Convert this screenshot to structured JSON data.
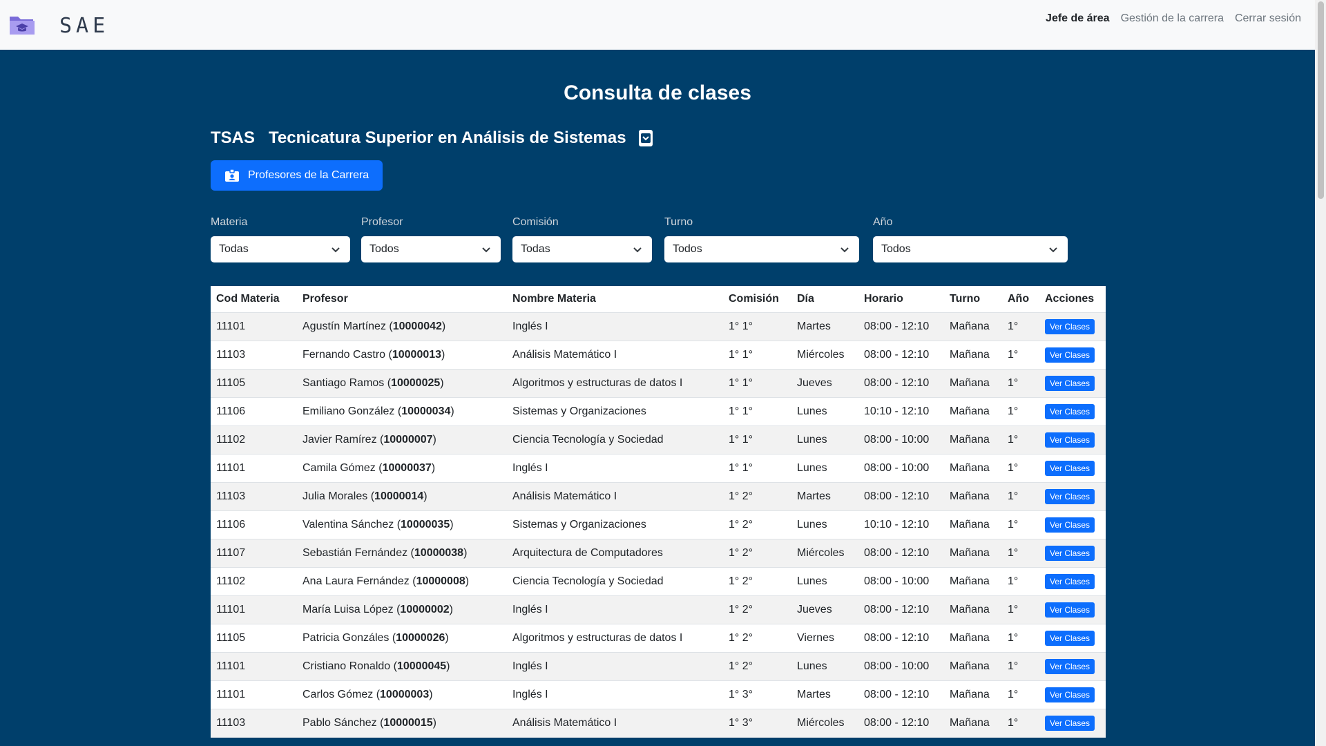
{
  "brand": {
    "name": "SAE",
    "logo_icon": "folder-graduation-icon"
  },
  "nav": {
    "links": [
      {
        "label": "Jefe de área",
        "active": true
      },
      {
        "label": "Gestión de la carrera",
        "active": false
      },
      {
        "label": "Cerrar sesión",
        "active": false
      }
    ]
  },
  "page": {
    "title": "Consulta de clases",
    "career_code": "TSAS",
    "career_name": "Tecnicatura Superior en Análisis de Sistemas",
    "professors_button": "Profesores de la Carrera"
  },
  "filters": [
    {
      "label": "Materia",
      "value": "Todas"
    },
    {
      "label": "Profesor",
      "value": "Todos"
    },
    {
      "label": "Comisión",
      "value": "Todas"
    },
    {
      "label": "Turno",
      "value": "Todos"
    },
    {
      "label": "Año",
      "value": "Todos"
    }
  ],
  "table": {
    "headers": [
      "Cod Materia",
      "Profesor",
      "Nombre Materia",
      "Comisión",
      "Día",
      "Horario",
      "Turno",
      "Año",
      "Acciones"
    ],
    "action_label": "Ver Clases",
    "rows": [
      {
        "cod": "11101",
        "prof": "Agustín Martínez",
        "dni": "10000042",
        "materia": "Inglés I",
        "comision": "1° 1°",
        "dia": "Martes",
        "horario": "08:00 - 12:10",
        "turno": "Mañana",
        "anio": "1°"
      },
      {
        "cod": "11103",
        "prof": "Fernando Castro",
        "dni": "10000013",
        "materia": "Análisis Matemático I",
        "comision": "1° 1°",
        "dia": "Miércoles",
        "horario": "08:00 - 12:10",
        "turno": "Mañana",
        "anio": "1°"
      },
      {
        "cod": "11105",
        "prof": "Santiago Ramos",
        "dni": "10000025",
        "materia": "Algoritmos y estructuras de datos I",
        "comision": "1° 1°",
        "dia": "Jueves",
        "horario": "08:00 - 12:10",
        "turno": "Mañana",
        "anio": "1°"
      },
      {
        "cod": "11106",
        "prof": "Emiliano González",
        "dni": "10000034",
        "materia": "Sistemas y Organizaciones",
        "comision": "1° 1°",
        "dia": "Lunes",
        "horario": "10:10 - 12:10",
        "turno": "Mañana",
        "anio": "1°"
      },
      {
        "cod": "11102",
        "prof": "Javier Ramírez",
        "dni": "10000007",
        "materia": "Ciencia Tecnología y Sociedad",
        "comision": "1° 1°",
        "dia": "Lunes",
        "horario": "08:00 - 10:00",
        "turno": "Mañana",
        "anio": "1°"
      },
      {
        "cod": "11101",
        "prof": "Camila Gómez",
        "dni": "10000037",
        "materia": "Inglés I",
        "comision": "1° 1°",
        "dia": "Lunes",
        "horario": "08:00 - 10:00",
        "turno": "Mañana",
        "anio": "1°"
      },
      {
        "cod": "11103",
        "prof": "Julia Morales",
        "dni": "10000014",
        "materia": "Análisis Matemático I",
        "comision": "1° 2°",
        "dia": "Martes",
        "horario": "08:00 - 12:10",
        "turno": "Mañana",
        "anio": "1°"
      },
      {
        "cod": "11106",
        "prof": "Valentina Sánchez",
        "dni": "10000035",
        "materia": "Sistemas y Organizaciones",
        "comision": "1° 2°",
        "dia": "Lunes",
        "horario": "10:10 - 12:10",
        "turno": "Mañana",
        "anio": "1°"
      },
      {
        "cod": "11107",
        "prof": "Sebastián Fernández",
        "dni": "10000038",
        "materia": "Arquitectura de Computadores",
        "comision": "1° 2°",
        "dia": "Miércoles",
        "horario": "08:00 - 12:10",
        "turno": "Mañana",
        "anio": "1°"
      },
      {
        "cod": "11102",
        "prof": "Ana Laura Fernández",
        "dni": "10000008",
        "materia": "Ciencia Tecnología y Sociedad",
        "comision": "1° 2°",
        "dia": "Lunes",
        "horario": "08:00 - 10:00",
        "turno": "Mañana",
        "anio": "1°"
      },
      {
        "cod": "11101",
        "prof": "María Luisa López",
        "dni": "10000002",
        "materia": "Inglés I",
        "comision": "1° 2°",
        "dia": "Jueves",
        "horario": "08:00 - 12:10",
        "turno": "Mañana",
        "anio": "1°"
      },
      {
        "cod": "11105",
        "prof": "Patricia Gonzáles",
        "dni": "10000026",
        "materia": "Algoritmos y estructuras de datos I",
        "comision": "1° 2°",
        "dia": "Viernes",
        "horario": "08:00 - 12:10",
        "turno": "Mañana",
        "anio": "1°"
      },
      {
        "cod": "11101",
        "prof": "Cristiano Ronaldo",
        "dni": "10000045",
        "materia": "Inglés I",
        "comision": "1° 2°",
        "dia": "Lunes",
        "horario": "08:00 - 10:00",
        "turno": "Mañana",
        "anio": "1°"
      },
      {
        "cod": "11101",
        "prof": "Carlos Gómez",
        "dni": "10000003",
        "materia": "Inglés I",
        "comision": "1° 3°",
        "dia": "Martes",
        "horario": "08:00 - 12:10",
        "turno": "Mañana",
        "anio": "1°"
      },
      {
        "cod": "11103",
        "prof": "Pablo Sánchez",
        "dni": "10000015",
        "materia": "Análisis Matemático I",
        "comision": "1° 3°",
        "dia": "Miércoles",
        "horario": "08:00 - 12:10",
        "turno": "Mañana",
        "anio": "1°"
      }
    ]
  },
  "colors": {
    "background": "#003f6b",
    "primary": "#0d6efd",
    "navbar": "#f8f9fa"
  }
}
